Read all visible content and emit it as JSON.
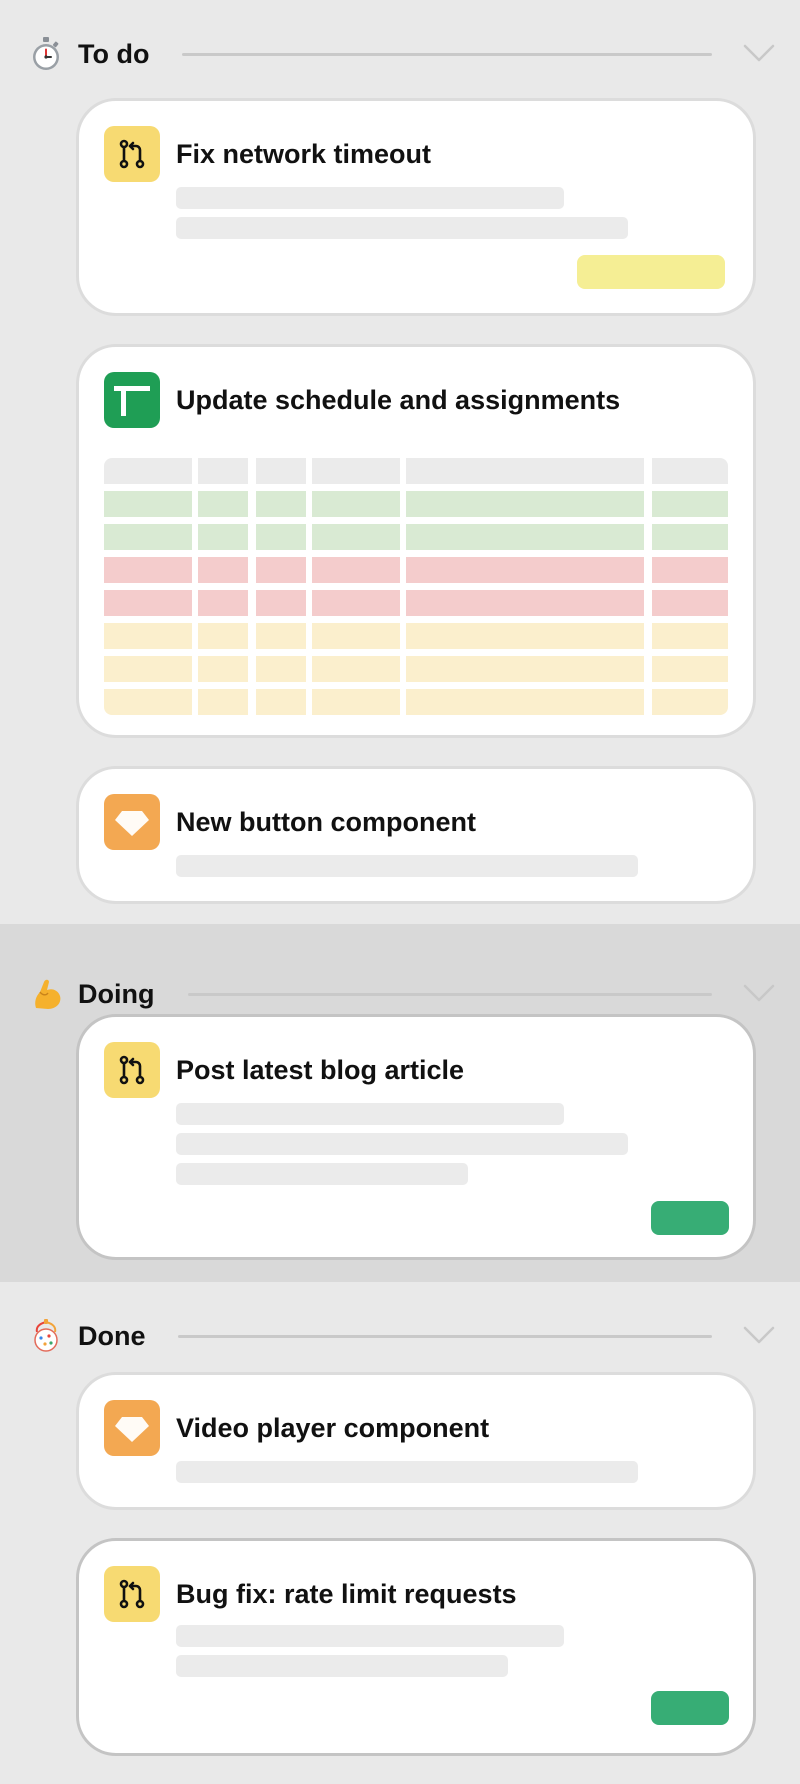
{
  "columns": [
    {
      "id": "todo",
      "title": "To do",
      "emoji_icon": "stopwatch-icon",
      "cards": [
        {
          "title": "Fix network timeout",
          "icon": "pull-request-icon",
          "action": "yellow-pill"
        },
        {
          "title": "Update schedule and assignments",
          "icon": "spreadsheet-icon"
        },
        {
          "title": "New button component",
          "icon": "sketch-diamond-icon"
        }
      ]
    },
    {
      "id": "doing",
      "title": "Doing",
      "emoji_icon": "flexed-biceps-icon",
      "cards": [
        {
          "title": "Post latest blog article",
          "icon": "pull-request-icon",
          "action": "green-pill"
        }
      ]
    },
    {
      "id": "done",
      "title": "Done",
      "emoji_icon": "confetti-ball-icon",
      "cards": [
        {
          "title": "Video player component",
          "icon": "sketch-diamond-icon"
        },
        {
          "title": "Bug fix: rate limit requests",
          "icon": "pull-request-icon",
          "action": "green-pill"
        }
      ]
    }
  ],
  "sheet_rows": [
    "header",
    "green",
    "green",
    "red",
    "red",
    "yellow",
    "yellow",
    "yellow"
  ],
  "colors": {
    "pr_icon_bg": "#f7da72",
    "sheet_icon_bg": "#1f9e55",
    "sketch_icon_bg": "#f3a852",
    "accent_green": "#37ad75",
    "accent_yellow": "#f5ee94",
    "row_header": "#ebebeb",
    "row_green": "#d9ead3",
    "row_red": "#f4cccc",
    "row_yellow": "#fbefcd"
  }
}
